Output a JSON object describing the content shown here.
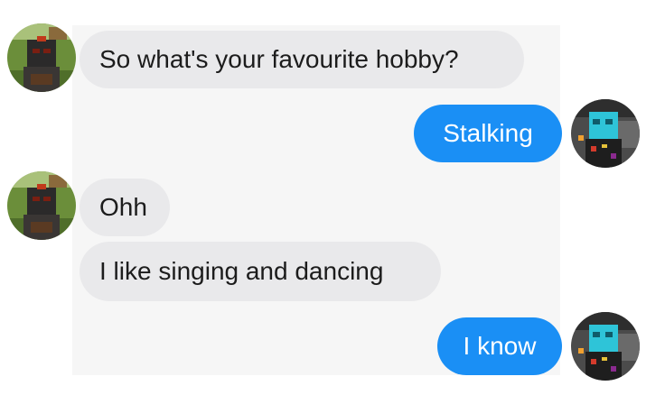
{
  "conversation": {
    "messages": [
      {
        "sender": "contact",
        "text": "So what's your favourite hobby?"
      },
      {
        "sender": "me",
        "text": "Stalking"
      },
      {
        "sender": "contact",
        "text": "Ohh"
      },
      {
        "sender": "contact",
        "text": "I like singing and dancing"
      },
      {
        "sender": "me",
        "text": "I know"
      }
    ]
  },
  "avatars": {
    "contact": "minecraft-dark-skin-avatar",
    "me": "minecraft-blue-skin-avatar"
  },
  "colors": {
    "incoming_bubble": "#e9e9eb",
    "outgoing_bubble": "#1a8ff5",
    "chat_background": "#f6f6f6"
  }
}
